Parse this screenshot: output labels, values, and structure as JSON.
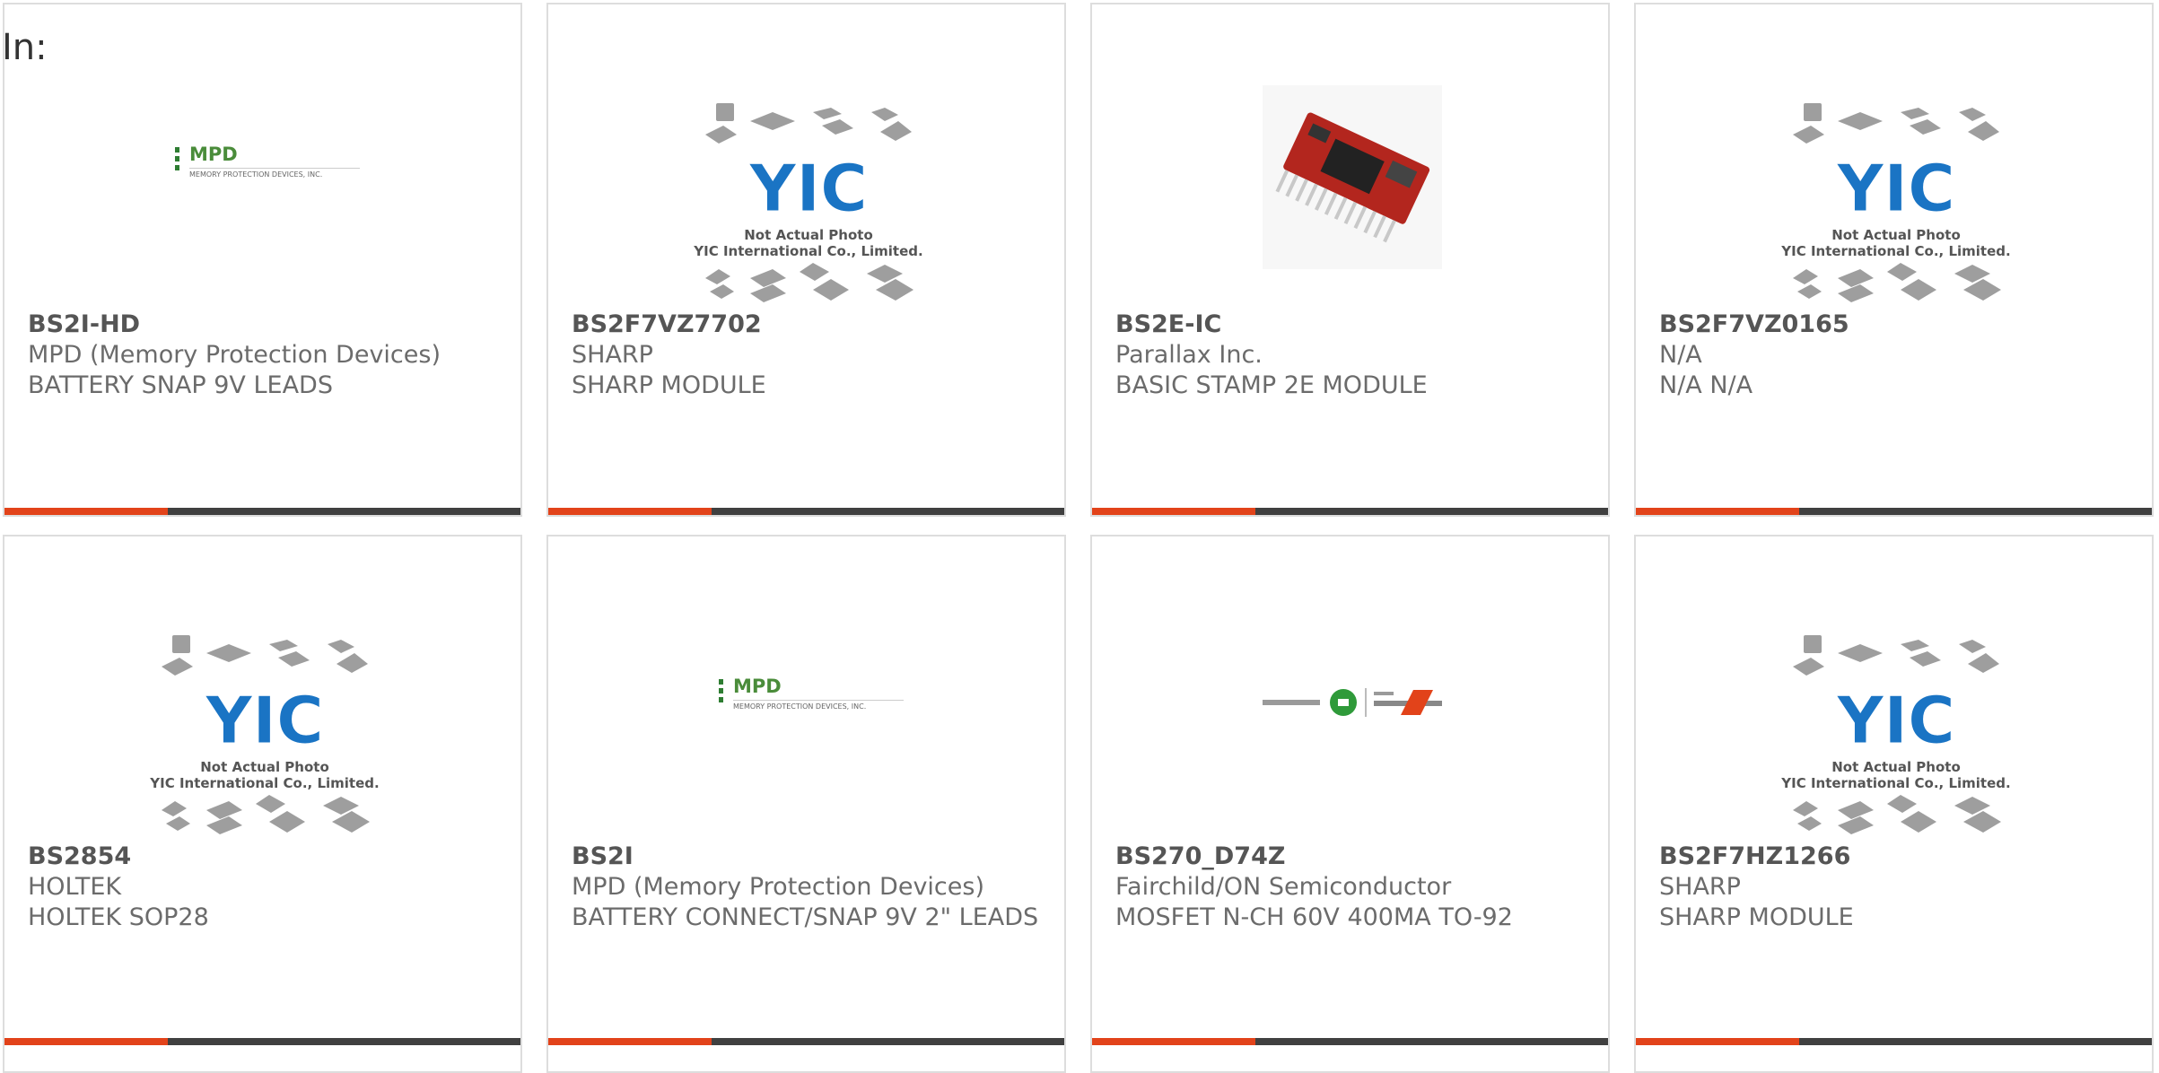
{
  "heading": "In:",
  "placeholder": {
    "line1": "Not Actual Photo",
    "line2": "YIC International Co., Limited.",
    "logo": "YIC"
  },
  "mpd_logo": {
    "word": "MPD",
    "sub": "MEMORY PROTECTION DEVICES, INC."
  },
  "colors": {
    "accent": "#e2431a",
    "bar": "#404040",
    "mpd_green": "#4a8c3a",
    "yic_blue": "#1a74c4",
    "module_red": "#b3261e"
  },
  "products": [
    {
      "part": "BS2I-HD",
      "maker": "MPD (Memory Protection Devices)",
      "desc": "BATTERY SNAP 9V LEADS",
      "image": "mpd-logo"
    },
    {
      "part": "BS2F7VZ7702",
      "maker": "SHARP",
      "desc": "SHARP MODULE",
      "image": "placeholder"
    },
    {
      "part": "BS2E-IC",
      "maker": "Parallax Inc.",
      "desc": "BASIC STAMP 2E MODULE",
      "image": "module-photo"
    },
    {
      "part": "BS2F7VZ0165",
      "maker": "N/A",
      "desc": "N/A N/A",
      "image": "placeholder"
    },
    {
      "part": "BS2854",
      "maker": "HOLTEK",
      "desc": "HOLTEK SOP28",
      "image": "placeholder"
    },
    {
      "part": "BS2I",
      "maker": "MPD (Memory Protection Devices)",
      "desc": "BATTERY CONNECT/SNAP 9V 2\" LEADS",
      "image": "mpd-logo"
    },
    {
      "part": "BS270_D74Z",
      "maker": "Fairchild/ON Semiconductor",
      "desc": "MOSFET N-CH 60V 400MA TO-92",
      "image": "fairchild-logo"
    },
    {
      "part": "BS2F7HZ1266",
      "maker": "SHARP",
      "desc": "SHARP MODULE",
      "image": "placeholder"
    }
  ]
}
